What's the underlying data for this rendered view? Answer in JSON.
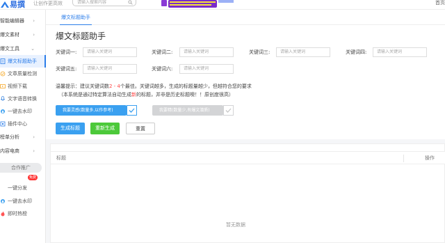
{
  "header": {
    "logo_text": "易撰",
    "slogan": "让创作更高效",
    "search_placeholder": "请输入搜索内容",
    "right_text": "首页"
  },
  "sidebar": {
    "items": [
      {
        "label": "智能编辑器",
        "chevron": "›"
      },
      {
        "label": "爆文素材",
        "chevron": "›"
      },
      {
        "label": "爆文工具",
        "chevron": "⌄"
      }
    ],
    "sub_items": [
      {
        "label": "爆文标题助手",
        "icon": "document-icon"
      },
      {
        "label": "文章质量检测",
        "icon": "quality-icon"
      },
      {
        "label": "视频下载",
        "icon": "video-icon"
      },
      {
        "label": "文字语音转换",
        "icon": "speech-icon"
      },
      {
        "label": "一键去水印",
        "icon": "watermark-icon"
      },
      {
        "label": "插件中心",
        "icon": "plugin-icon"
      }
    ],
    "items2": [
      {
        "label": "榜单分析",
        "chevron": "›"
      },
      {
        "label": "内容电商",
        "chevron": "›"
      }
    ],
    "promo_header": "合作推广",
    "promo_items": [
      {
        "label": "一键分发",
        "badge": "免费"
      },
      {
        "label": "一键去水印"
      },
      {
        "label": "即时热榜"
      }
    ]
  },
  "tabs": [
    {
      "label": "爆文标题助手"
    }
  ],
  "page_title": "爆文标题助手",
  "keywords": [
    {
      "label": "关键词一:",
      "placeholder": "请输入关键词"
    },
    {
      "label": "关键词二:",
      "placeholder": "请输入关键词"
    },
    {
      "label": "关键词三:",
      "placeholder": "请输入关键词"
    },
    {
      "label": "关键词四:",
      "placeholder": "请输入关键词"
    },
    {
      "label": "关键词五:",
      "placeholder": "请输入关键词"
    },
    {
      "label": "关键词六:",
      "placeholder": "请输入关键词"
    }
  ],
  "tip": {
    "line1_a": "温馨提示：建议关键词数",
    "line1_red": "2 - 4",
    "line1_b": "个最佳。关键词越多，生成的标题量越少，但越符合您的要求",
    "line2_a": "（本系统是通过特定算法自动生成",
    "line2_red": "新",
    "line2_b": "的标题，并非是历史标题噢！！原创度很高）"
  },
  "options": {
    "more_label": "我要灵感(数量多,以作参考)",
    "precise_label": "我要精(数量少,有爆文潜质)"
  },
  "actions": {
    "generate": "生成标题",
    "regenerate": "重新生成",
    "reset": "重置"
  },
  "table": {
    "col_title": "标题",
    "col_action": "操作",
    "empty_text": "暂无数据"
  },
  "colors": {
    "accent": "#2b7de9",
    "primary_btn": "#3aa0f0",
    "green_btn": "#4cc93a"
  }
}
